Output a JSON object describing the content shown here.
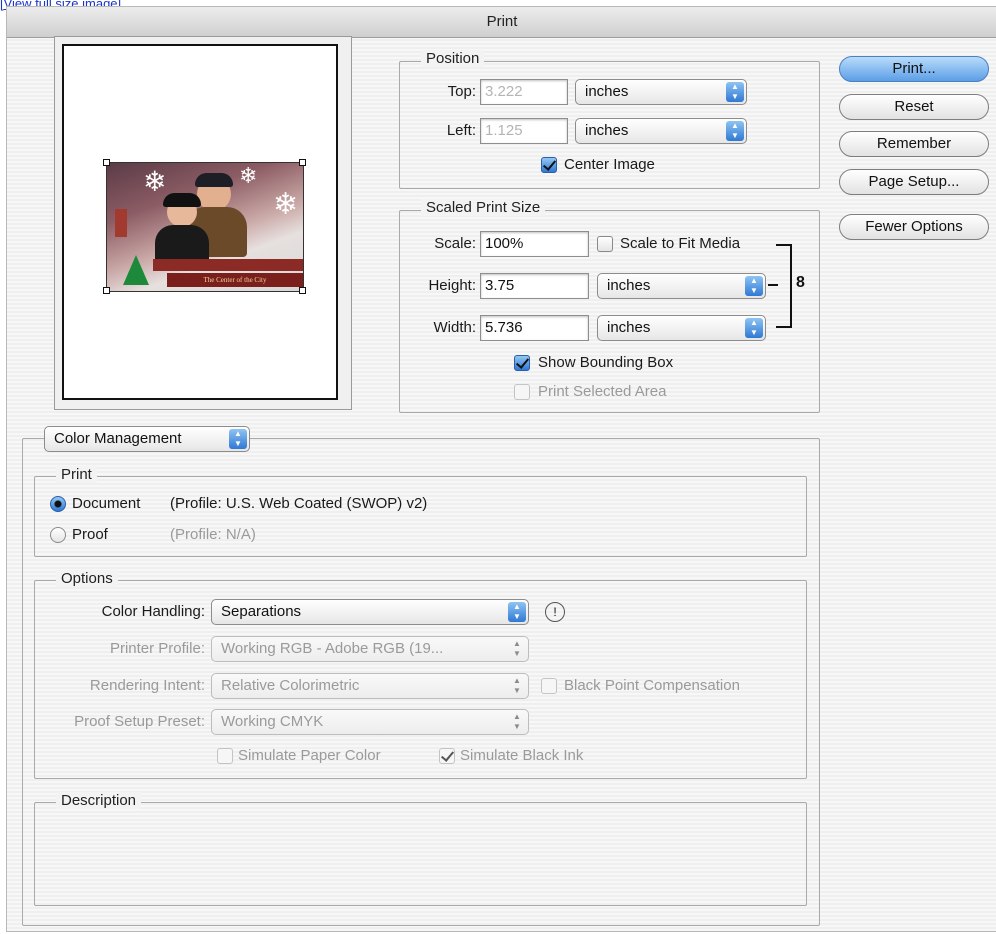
{
  "top_link": "[View full size image]",
  "window_title": "Print",
  "position": {
    "legend": "Position",
    "top_label": "Top:",
    "top_value": "3.222",
    "top_unit": "inches",
    "left_label": "Left:",
    "left_value": "1.125",
    "left_unit": "inches",
    "center_image_label": "Center Image",
    "center_image_checked": true
  },
  "scaled": {
    "legend": "Scaled Print Size",
    "scale_label": "Scale:",
    "scale_value": "100%",
    "scale_to_fit_label": "Scale to Fit Media",
    "height_label": "Height:",
    "height_value": "3.75",
    "height_unit": "inches",
    "width_label": "Width:",
    "width_value": "5.736",
    "width_unit": "inches",
    "show_bbox_label": "Show Bounding Box",
    "show_bbox_checked": true,
    "print_selected_label": "Print Selected Area"
  },
  "buttons": {
    "print": "Print...",
    "reset": "Reset",
    "remember": "Remember",
    "page_setup": "Page Setup...",
    "fewer_options": "Fewer Options"
  },
  "section_popup": "Color Management",
  "print_group": {
    "legend": "Print",
    "document_label": "Document",
    "document_profile": "(Profile: U.S. Web Coated (SWOP) v2)",
    "proof_label": "Proof",
    "proof_profile": "(Profile: N/A)",
    "selected": "Document"
  },
  "options": {
    "legend": "Options",
    "color_handling_label": "Color Handling:",
    "color_handling_value": "Separations",
    "printer_profile_label": "Printer Profile:",
    "printer_profile_value": "Working RGB - Adobe RGB (19...",
    "rendering_intent_label": "Rendering Intent:",
    "rendering_intent_value": "Relative Colorimetric",
    "black_point_label": "Black Point Compensation",
    "proof_setup_label": "Proof Setup Preset:",
    "proof_setup_value": "Working CMYK",
    "simulate_paper_label": "Simulate Paper Color",
    "simulate_black_label": "Simulate Black Ink",
    "simulate_black_checked": true,
    "info_icon": "!"
  },
  "description": {
    "legend": "Description"
  },
  "preview": {
    "card_title": "",
    "card_subtitle": "The Center of the City"
  }
}
